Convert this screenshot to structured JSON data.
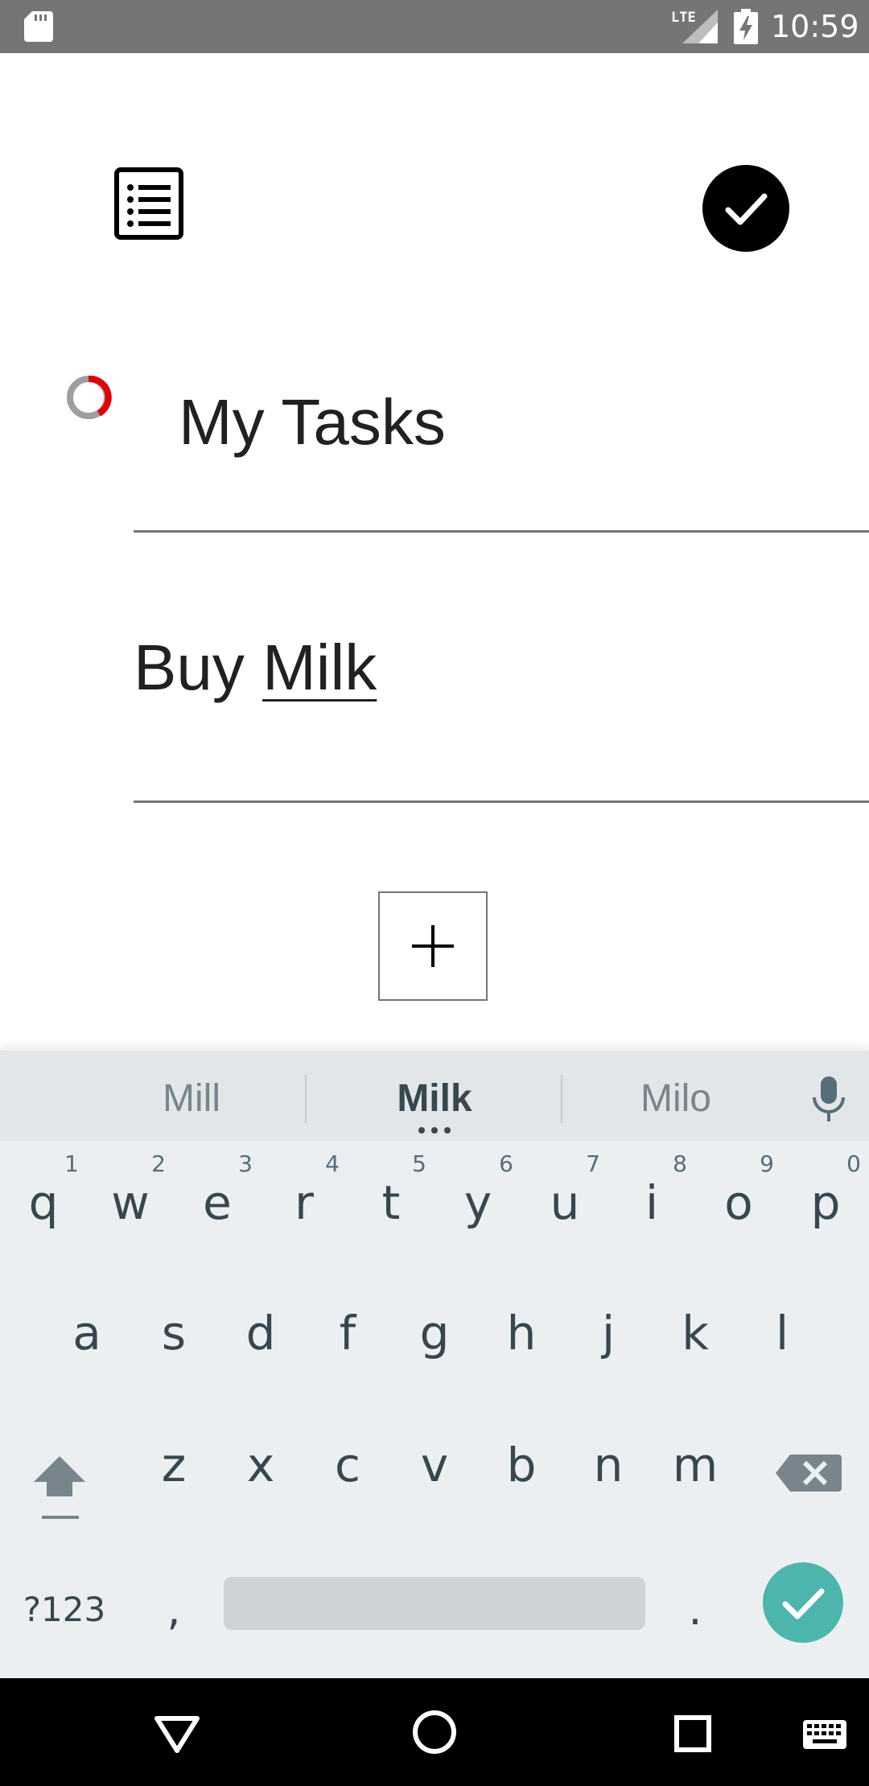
{
  "status_bar": {
    "time": "10:59",
    "network_label": "LTE",
    "icons": [
      "sd-card-icon",
      "signal-icon",
      "battery-charging-icon"
    ],
    "background": "#757575"
  },
  "toolbar": {
    "list_icon": "list-icon",
    "done_icon": "check-circle-icon"
  },
  "editor": {
    "progress_icon": "progress-ring-icon",
    "title_value": "My Tasks",
    "task_word_1": "Buy",
    "task_word_2": "Milk",
    "add_icon": "plus-icon"
  },
  "keyboard": {
    "suggestions": [
      "Mill",
      "Milk",
      "Milo"
    ],
    "row1": [
      {
        "ch": "q",
        "num": "1"
      },
      {
        "ch": "w",
        "num": "2"
      },
      {
        "ch": "e",
        "num": "3"
      },
      {
        "ch": "r",
        "num": "4"
      },
      {
        "ch": "t",
        "num": "5"
      },
      {
        "ch": "y",
        "num": "6"
      },
      {
        "ch": "u",
        "num": "7"
      },
      {
        "ch": "i",
        "num": "8"
      },
      {
        "ch": "o",
        "num": "9"
      },
      {
        "ch": "p",
        "num": "0"
      }
    ],
    "row2": [
      "a",
      "s",
      "d",
      "f",
      "g",
      "h",
      "j",
      "k",
      "l"
    ],
    "row3": [
      "z",
      "x",
      "c",
      "v",
      "b",
      "n",
      "m"
    ],
    "symbols_label": "?123",
    "comma_label": ",",
    "period_label": ".",
    "enter_color": "#4db6ac",
    "background": "#eceff1"
  },
  "nav_bar": {
    "buttons": [
      "back-icon",
      "home-icon",
      "recents-icon",
      "keyboard-icon"
    ]
  }
}
